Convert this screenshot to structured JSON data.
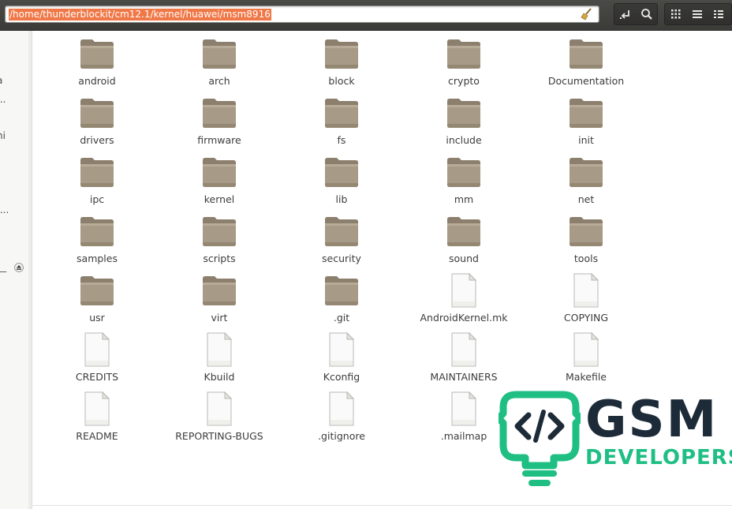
{
  "location": {
    "path": "/home/thunderblockit/cm12.1/kernel/huawei/msm8916"
  },
  "toolbar": {
    "buttons": [
      {
        "name": "go-to-parent-icon"
      },
      {
        "name": "search-icon"
      },
      {
        "name": "icon-view-icon"
      },
      {
        "name": "list-view-icon"
      },
      {
        "name": "menu-icon"
      }
    ]
  },
  "sidebar": {
    "fragments": [
      "a",
      "...",
      "ni",
      "i",
      "....",
      "__"
    ]
  },
  "files": [
    {
      "label": "android",
      "kind": "folder"
    },
    {
      "label": "arch",
      "kind": "folder"
    },
    {
      "label": "block",
      "kind": "folder"
    },
    {
      "label": "crypto",
      "kind": "folder"
    },
    {
      "label": "Documentation",
      "kind": "folder"
    },
    {
      "label": "drivers",
      "kind": "folder"
    },
    {
      "label": "firmware",
      "kind": "folder"
    },
    {
      "label": "fs",
      "kind": "folder"
    },
    {
      "label": "include",
      "kind": "folder"
    },
    {
      "label": "init",
      "kind": "folder"
    },
    {
      "label": "ipc",
      "kind": "folder"
    },
    {
      "label": "kernel",
      "kind": "folder"
    },
    {
      "label": "lib",
      "kind": "folder"
    },
    {
      "label": "mm",
      "kind": "folder"
    },
    {
      "label": "net",
      "kind": "folder"
    },
    {
      "label": "samples",
      "kind": "folder"
    },
    {
      "label": "scripts",
      "kind": "folder"
    },
    {
      "label": "security",
      "kind": "folder"
    },
    {
      "label": "sound",
      "kind": "folder"
    },
    {
      "label": "tools",
      "kind": "folder"
    },
    {
      "label": "usr",
      "kind": "folder"
    },
    {
      "label": "virt",
      "kind": "folder"
    },
    {
      "label": ".git",
      "kind": "folder"
    },
    {
      "label": "AndroidKernel.mk",
      "kind": "file"
    },
    {
      "label": "COPYING",
      "kind": "file"
    },
    {
      "label": "CREDITS",
      "kind": "file"
    },
    {
      "label": "Kbuild",
      "kind": "file"
    },
    {
      "label": "Kconfig",
      "kind": "file"
    },
    {
      "label": "MAINTAINERS",
      "kind": "file"
    },
    {
      "label": "Makefile",
      "kind": "file"
    },
    {
      "label": "README",
      "kind": "file"
    },
    {
      "label": "REPORTING-BUGS",
      "kind": "file"
    },
    {
      "label": ".gitignore",
      "kind": "file"
    },
    {
      "label": ".mailmap",
      "kind": "file"
    }
  ],
  "watermark": {
    "line1": "GSM",
    "line2": "DEVELOPERS",
    "colors": {
      "dark": "#1d2b38",
      "green": "#1fbf84"
    }
  },
  "colors": {
    "selection": "#f07746",
    "folder": "#a79a87",
    "toolbar": "#3b3b38"
  }
}
